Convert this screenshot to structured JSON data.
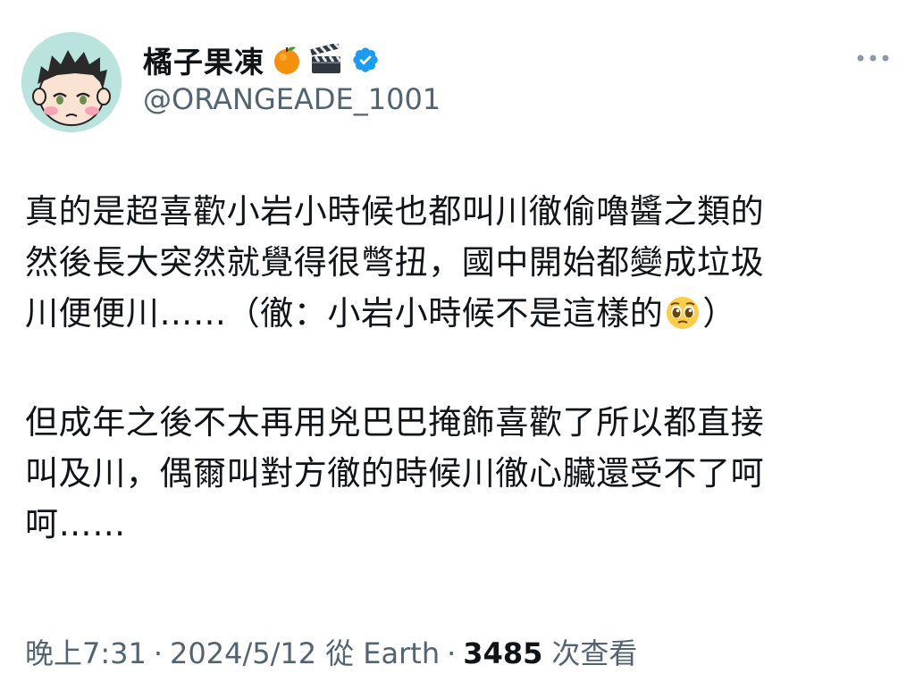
{
  "author": {
    "display_name": "橘子果凍",
    "name_emojis": [
      "orange-emoji",
      "clapper-board-emoji"
    ],
    "verified": true,
    "handle": "@ORANGEADE_1001"
  },
  "tweet": {
    "paragraphs": [
      {
        "lines": [
          "真的是超喜歡小岩小時候也都叫川徹偷嚕醬之類的",
          "然後長大突然就覺得很彆扭，國中開始都變成垃圾",
          "川便便川……（徹：小岩小時候不是這樣的"
        ],
        "trailing_emoji": "pleading-face-emoji",
        "closing": "）"
      },
      {
        "lines": [
          "但成年之後不太再用兇巴巴掩飾喜歡了所以都直接",
          "叫及川，偶爾叫對方徹的時候川徹心臟還受不了呵",
          "呵……"
        ]
      }
    ]
  },
  "meta": {
    "time": "晚上7:31",
    "date": "2024/5/12",
    "location": "從 Earth",
    "separator": "·",
    "views": "3485",
    "views_label": "次查看"
  },
  "colors": {
    "text": "#0f1419",
    "secondary": "#536471",
    "verified_blue": "#1d9bf0",
    "avatar_bg": "#b9e3dc"
  }
}
